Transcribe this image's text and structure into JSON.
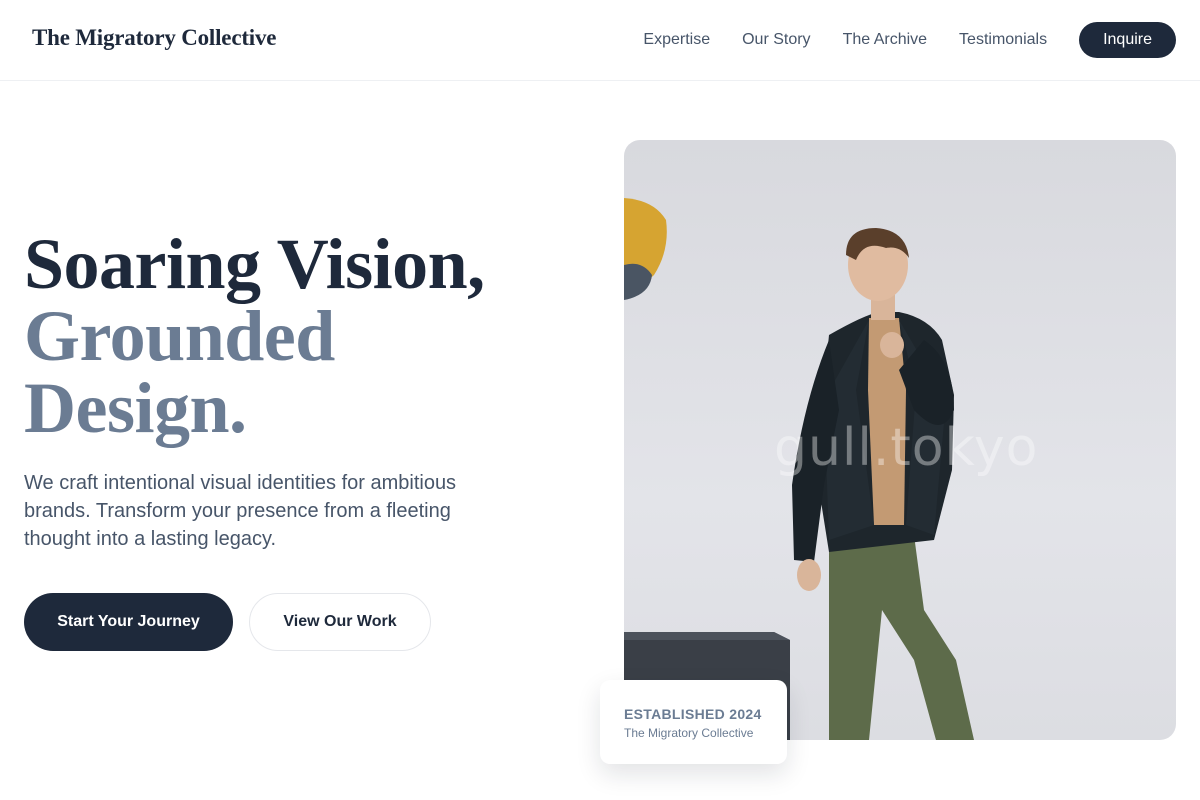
{
  "nav": {
    "brand": "The Migratory Collective",
    "links": [
      "Expertise",
      "Our Story",
      "The Archive",
      "Testimonials"
    ],
    "cta": "Inquire"
  },
  "hero": {
    "title_line1": "Soaring Vision,",
    "title_line2": "Grounded",
    "title_line3": "Design.",
    "subtitle": "We craft intentional visual identities for ambitious brands. Transform your presence from a fleeting thought into a lasting legacy.",
    "primary_button": "Start Your Journey",
    "secondary_button": "View Our Work"
  },
  "photo": {
    "watermark": "gull.tokyo"
  },
  "badge": {
    "title": "ESTABLISHED 2024",
    "subtitle": "The Migratory Collective"
  },
  "colors": {
    "primary": "#1e293b",
    "muted_heading": "#6b7c93",
    "body_text": "#475569"
  }
}
